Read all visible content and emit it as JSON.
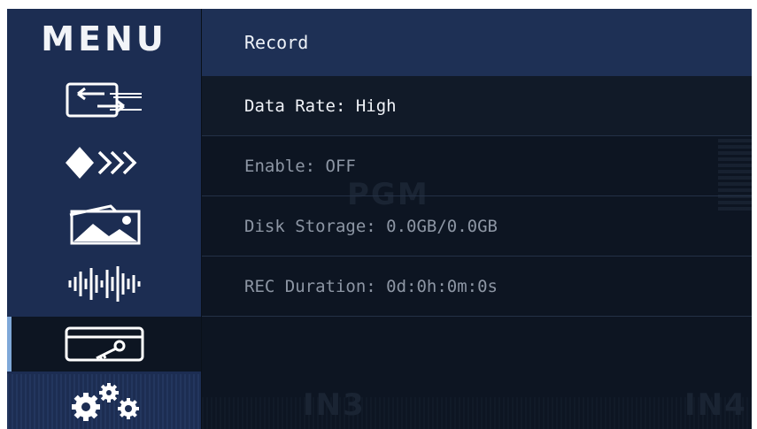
{
  "sidebar": {
    "title": "MENU",
    "items": [
      {
        "icon": "input-switch-icon",
        "selected": false
      },
      {
        "icon": "transition-arrows-icon",
        "selected": false
      },
      {
        "icon": "picture-gallery-icon",
        "selected": false
      },
      {
        "icon": "audio-waveform-icon",
        "selected": false
      },
      {
        "icon": "recording-key-card-icon",
        "selected": true
      },
      {
        "icon": "settings-gears-icon",
        "selected": false
      }
    ]
  },
  "panel": {
    "header": "Record",
    "rows": [
      {
        "label": "Data Rate: High"
      },
      {
        "label": "Enable: OFF"
      },
      {
        "label": "Disk Storage: 0.0GB/0.0GB"
      },
      {
        "label": "REC Duration: 0d:0h:0m:0s"
      }
    ]
  },
  "background": {
    "pgm": "PGM",
    "in3": "IN3",
    "in4": "IN4"
  },
  "colors": {
    "sidebar": "#1c2d52",
    "header": "#1e3055",
    "panel": "#0d1522",
    "selection_accent": "#7fa8d8"
  }
}
